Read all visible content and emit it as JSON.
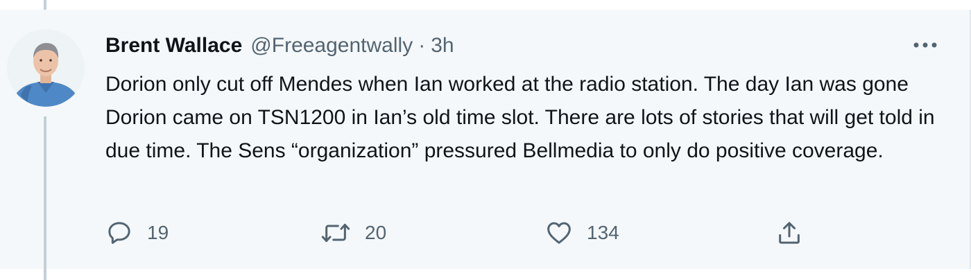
{
  "tweet": {
    "author_name": "Brent Wallace",
    "handle": "@Freeagentwally",
    "separator": "·",
    "time": "3h",
    "text": "Dorion only cut off Mendes when Ian worked at the radio station. The day Ian was gone Dorion came on TSN1200 in Ian’s old time slot. There are lots of stories that will get told in due time. The Sens “organization” pressured Bellmedia to only do positive coverage.",
    "actions": {
      "reply_count": "19",
      "retweet_count": "20",
      "like_count": "134"
    }
  },
  "icons": {
    "reply": "speech-bubble-icon",
    "retweet": "retweet-arrows-icon",
    "like": "heart-icon",
    "share": "share-upload-icon",
    "more": "ellipsis-icon"
  },
  "colors": {
    "background": "#f5f8fa",
    "text": "#0f1419",
    "secondary_text": "#536471",
    "thread_line": "#c4cfd6"
  }
}
